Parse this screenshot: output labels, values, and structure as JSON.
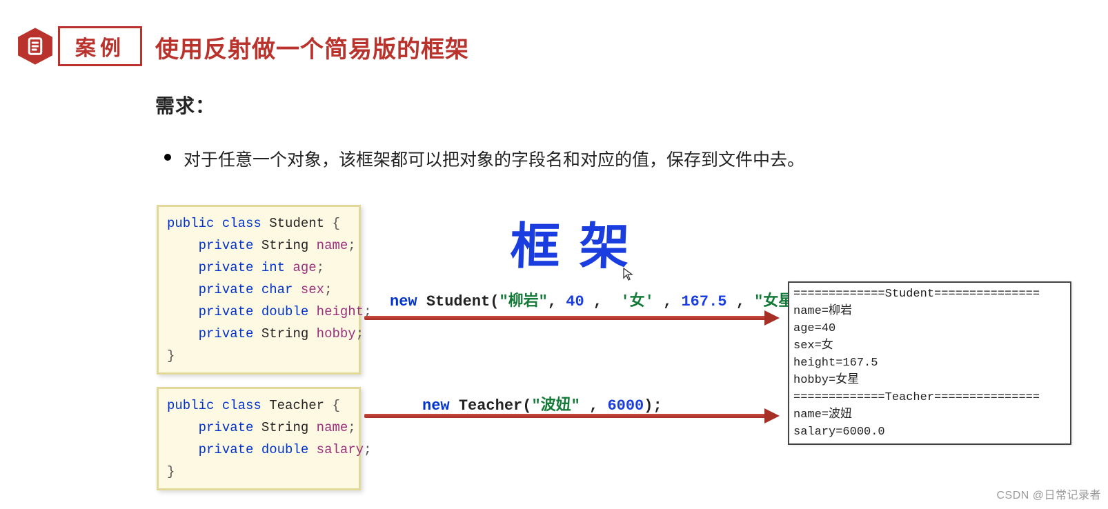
{
  "header": {
    "badge_label": "案例",
    "title": "使用反射做一个简易版的框架"
  },
  "requirement": {
    "label": "需求：",
    "bullet": "对于任意一个对象，该框架都可以把对象的字段名和对应的值，保存到文件中去。"
  },
  "code": {
    "student": {
      "line1_public": "public",
      "line1_class": "class",
      "line1_name": "Student",
      "line1_brace": "{",
      "f_private": "private",
      "t_string": "String",
      "t_int": "int",
      "t_char": "char",
      "t_double": "double",
      "f_name": "name",
      "f_age": "age",
      "f_sex": "sex",
      "f_height": "height",
      "f_hobby": "hobby",
      "semi": ";",
      "rbrace": "}"
    },
    "teacher": {
      "line1_public": "public",
      "line1_class": "class",
      "line1_name": "Teacher",
      "line1_brace": "{",
      "f_private": "private",
      "t_string": "String",
      "t_double": "double",
      "f_name": "name",
      "f_salary": "salary",
      "semi": ";",
      "rbrace": "}"
    }
  },
  "handwriting": "框架",
  "ctor": {
    "stu": {
      "new": "new",
      "cls": "Student",
      "open": "(",
      "s1": "\"柳岩\"",
      "c1": ",",
      "n1": "40",
      "c2": ",",
      "ch": "'女'",
      "c3": ",",
      "n2": "167.5",
      "c4": ",",
      "s2": "\"女星\"",
      "close": ");"
    },
    "tea": {
      "new": "new",
      "cls": "Teacher",
      "open": "(",
      "s1": "\"波妞\"",
      "c1": ",",
      "n1": "6000",
      "close": ");"
    }
  },
  "output": {
    "l1": "=============Student===============",
    "l2": "name=柳岩",
    "l3": "age=40",
    "l4": "sex=女",
    "l5": "height=167.5",
    "l6": "hobby=女星",
    "l7": "=============Teacher===============",
    "l8": "name=波妞",
    "l9": "salary=6000.0"
  },
  "watermark": "CSDN @日常记录者"
}
